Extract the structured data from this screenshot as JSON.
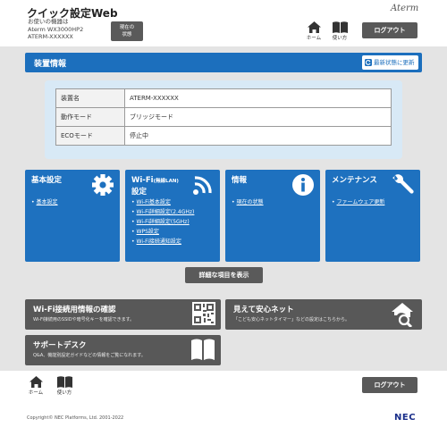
{
  "header": {
    "title": "クイック設定Web",
    "device_lines": [
      "お使いの機器は",
      "Aterm WX3000HP2",
      "ATERM-XXXXXX"
    ],
    "status_button": [
      "現在の",
      "状態"
    ],
    "brand": "Aterm",
    "home_label": "ホーム",
    "help_label": "使い方",
    "logout_label": "ログアウト"
  },
  "device_section": {
    "title": "装置情報",
    "refresh_label": "最新状態に更新",
    "rows": [
      {
        "key": "装置名",
        "value": "ATERM-XXXXXX"
      },
      {
        "key": "動作モード",
        "value": "ブリッジモード"
      },
      {
        "key": "ECOモード",
        "value": "停止中"
      }
    ]
  },
  "tiles": [
    {
      "title": "基本設定",
      "title_small": "",
      "title_line2": "",
      "icon": "gear-icon",
      "links": [
        "基本設定"
      ]
    },
    {
      "title": "Wi-Fi",
      "title_small": "(無線LAN)",
      "title_line2": "設定",
      "icon": "wifi-icon",
      "links": [
        "Wi-Fi基本設定",
        "Wi-Fi詳細設定(2.4GHz)",
        "Wi-Fi詳細設定(5GHz)",
        "WPS設定",
        "Wi-Fi接続通知設定"
      ]
    },
    {
      "title": "情報",
      "title_small": "",
      "title_line2": "",
      "icon": "info-icon",
      "links": [
        "現在の状態"
      ]
    },
    {
      "title": "メンテナンス",
      "title_small": "",
      "title_line2": "",
      "icon": "wrench-icon",
      "links": [
        "ファームウェア更新"
      ]
    }
  ],
  "detail_button": "詳細な項目を表示",
  "banners": [
    {
      "title": "Wi-Fi接続用情報の確認",
      "desc": "Wi-Fi接続用のSSIDや暗号化キーを確認できます。",
      "icon": "qr-code-icon"
    },
    {
      "title": "見えて安心ネット",
      "desc": "「こども安心ネットタイマー」などの設定はこちらから。",
      "icon": "home-search-icon"
    },
    {
      "title": "サポートデスク",
      "desc": "Q&A、機能別設定ガイドなどの情報をご覧になれます。",
      "icon": "book-icon"
    }
  ],
  "footer": {
    "home_label": "ホーム",
    "help_label": "使い方",
    "logout_label": "ログアウト",
    "copyright": "Copyright© NEC Platforms, Ltd. 2001-2022",
    "logo": "NEC"
  },
  "colors": {
    "accent": "#1e71bf",
    "dark_button": "#585858",
    "panel": "#d8e9f6"
  }
}
